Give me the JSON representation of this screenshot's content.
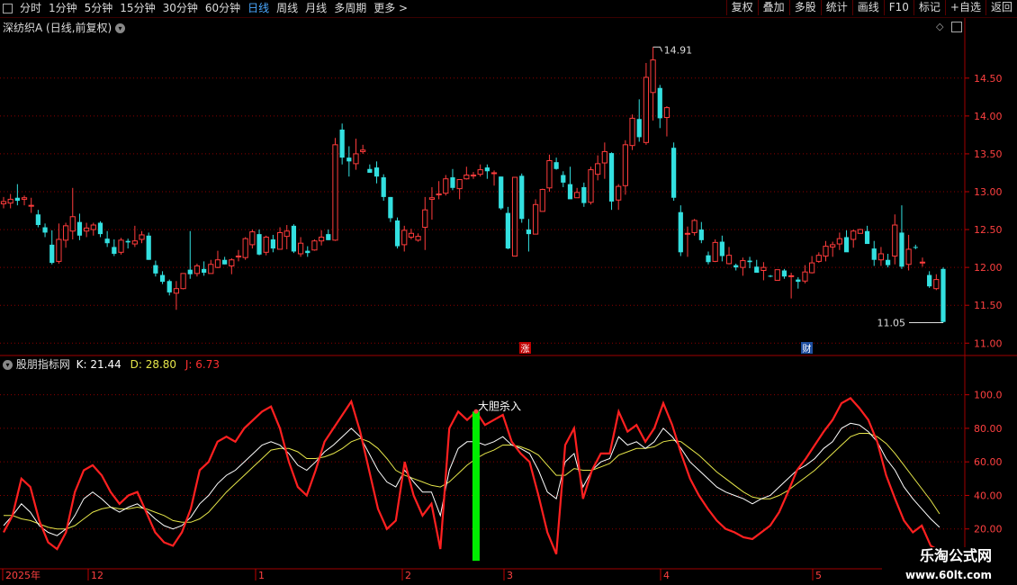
{
  "toolbar": {
    "periods": [
      "分时",
      "1分钟",
      "5分钟",
      "15分钟",
      "30分钟",
      "60分钟",
      "日线",
      "周线",
      "月线",
      "多周期",
      "更多 >"
    ],
    "active_period": "日线",
    "buttons": [
      "复权",
      "叠加",
      "多股",
      "统计",
      "画线",
      "F10",
      "标记",
      "+自选",
      "返回"
    ]
  },
  "main_chart": {
    "title": "深纺织A",
    "subtitle": "(日线,前复权)",
    "y_ticks": [
      "14.50",
      "14.00",
      "13.50",
      "13.00",
      "12.50",
      "12.00",
      "11.50",
      "11.00"
    ],
    "high_label": "14.91",
    "low_label": "11.05",
    "markers": [
      {
        "text": "涨",
        "color": "#c00000"
      },
      {
        "text": "财",
        "color": "#1f4fa0"
      }
    ]
  },
  "indicator": {
    "name": "股朋指标网",
    "k_label": "K: 21.44",
    "d_label": "D: 28.80",
    "j_label": "J: 6.73",
    "y_ticks": [
      "100.0",
      "80.00",
      "60.00",
      "40.00",
      "20.00"
    ],
    "signal_label": "大胆杀入"
  },
  "x_axis": {
    "labels": [
      "2025年",
      "12",
      "1",
      "2",
      "3",
      "4",
      "5"
    ]
  },
  "watermark": {
    "line1": "乐淘公式网",
    "line2": "www.60lt.com"
  },
  "colors": {
    "up": "#ff3c3c",
    "down": "#33e0e0",
    "k": "#ffffff",
    "d": "#e6e64a",
    "j": "#ff2020",
    "signal_bar": "#00ee00",
    "grid": "#8b0000"
  },
  "chart_data": {
    "type": "candlestick",
    "candles": [
      [
        12.84,
        12.93,
        12.78,
        12.87
      ],
      [
        12.85,
        12.97,
        12.78,
        12.9
      ],
      [
        12.92,
        13.1,
        12.82,
        12.88
      ],
      [
        12.9,
        12.95,
        12.82,
        12.92
      ],
      [
        12.82,
        12.92,
        12.72,
        12.82
      ],
      [
        12.7,
        12.76,
        12.53,
        12.56
      ],
      [
        12.53,
        12.58,
        12.4,
        12.46
      ],
      [
        12.3,
        12.49,
        12.04,
        12.06
      ],
      [
        12.08,
        12.58,
        12.05,
        12.37
      ],
      [
        12.36,
        12.59,
        12.26,
        12.55
      ],
      [
        12.48,
        13.05,
        12.37,
        12.67
      ],
      [
        12.6,
        12.71,
        12.36,
        12.42
      ],
      [
        12.48,
        12.59,
        12.4,
        12.52
      ],
      [
        12.5,
        12.59,
        12.42,
        12.56
      ],
      [
        12.59,
        12.61,
        12.4,
        12.44
      ],
      [
        12.38,
        12.48,
        12.27,
        12.32
      ],
      [
        12.27,
        12.37,
        12.15,
        12.18
      ],
      [
        12.2,
        12.39,
        12.17,
        12.36
      ],
      [
        12.35,
        12.38,
        12.25,
        12.33
      ],
      [
        12.31,
        12.55,
        12.27,
        12.35
      ],
      [
        12.37,
        12.48,
        12.32,
        12.43
      ],
      [
        12.42,
        12.46,
        12.1,
        12.1
      ],
      [
        12.03,
        12.09,
        11.88,
        11.92
      ],
      [
        11.9,
        11.95,
        11.78,
        11.81
      ],
      [
        11.82,
        11.84,
        11.63,
        11.67
      ],
      [
        11.66,
        11.82,
        11.44,
        11.72
      ],
      [
        11.72,
        11.92,
        11.71,
        11.92
      ],
      [
        11.97,
        12.48,
        11.85,
        11.91
      ],
      [
        11.92,
        12.05,
        11.88,
        12.02
      ],
      [
        11.98,
        12.08,
        11.89,
        11.93
      ],
      [
        11.92,
        12.1,
        11.92,
        12.04
      ],
      [
        12.0,
        12.22,
        11.99,
        12.1
      ],
      [
        12.1,
        12.14,
        12.04,
        12.04
      ],
      [
        12.02,
        12.12,
        11.91,
        12.1
      ],
      [
        12.14,
        12.23,
        12.08,
        12.15
      ],
      [
        12.13,
        12.4,
        12.1,
        12.38
      ],
      [
        12.3,
        12.5,
        12.25,
        12.47
      ],
      [
        12.44,
        12.5,
        12.16,
        12.17
      ],
      [
        12.2,
        12.42,
        12.16,
        12.4
      ],
      [
        12.37,
        12.43,
        12.2,
        12.25
      ],
      [
        12.24,
        12.53,
        12.24,
        12.46
      ],
      [
        12.41,
        12.56,
        12.24,
        12.48
      ],
      [
        12.55,
        12.57,
        12.19,
        12.21
      ],
      [
        12.18,
        12.4,
        12.14,
        12.32
      ],
      [
        12.22,
        12.28,
        12.14,
        12.19
      ],
      [
        12.23,
        12.37,
        12.22,
        12.35
      ],
      [
        12.35,
        12.49,
        12.29,
        12.4
      ],
      [
        12.44,
        12.5,
        12.36,
        12.36
      ],
      [
        12.36,
        13.71,
        12.35,
        13.62
      ],
      [
        13.82,
        13.9,
        13.36,
        13.45
      ],
      [
        13.45,
        13.6,
        13.2,
        13.4
      ],
      [
        13.37,
        13.7,
        13.29,
        13.5
      ],
      [
        13.53,
        13.62,
        13.5,
        13.55
      ],
      [
        13.3,
        13.36,
        13.25,
        13.25
      ],
      [
        13.32,
        13.4,
        13.11,
        13.2
      ],
      [
        13.19,
        13.23,
        12.88,
        12.93
      ],
      [
        12.93,
        12.93,
        12.6,
        12.65
      ],
      [
        12.62,
        12.66,
        12.25,
        12.28
      ],
      [
        12.3,
        12.55,
        12.21,
        12.49
      ],
      [
        12.4,
        12.51,
        12.37,
        12.45
      ],
      [
        12.36,
        12.45,
        12.34,
        12.41
      ],
      [
        12.53,
        12.93,
        12.23,
        12.76
      ],
      [
        12.9,
        13.06,
        12.63,
        12.92
      ],
      [
        12.96,
        13.14,
        12.9,
        12.97
      ],
      [
        12.98,
        13.22,
        12.95,
        13.17
      ],
      [
        13.19,
        13.3,
        13.02,
        13.05
      ],
      [
        13.04,
        13.16,
        12.9,
        13.16
      ],
      [
        13.17,
        13.33,
        13.16,
        13.22
      ],
      [
        13.21,
        13.26,
        13.17,
        13.22
      ],
      [
        13.23,
        13.36,
        13.2,
        13.29
      ],
      [
        13.32,
        13.36,
        13.17,
        13.27
      ],
      [
        13.24,
        13.28,
        13.08,
        13.25
      ],
      [
        13.2,
        13.2,
        12.76,
        12.78
      ],
      [
        12.72,
        12.8,
        12.24,
        12.25
      ],
      [
        12.15,
        13.19,
        12.15,
        13.19
      ],
      [
        13.21,
        13.24,
        12.59,
        12.64
      ],
      [
        12.5,
        12.64,
        12.21,
        12.44
      ],
      [
        12.44,
        12.9,
        12.44,
        12.83
      ],
      [
        12.74,
        13.04,
        12.74,
        13.03
      ],
      [
        13.05,
        13.49,
        13.0,
        13.41
      ],
      [
        13.39,
        13.45,
        13.29,
        13.3
      ],
      [
        13.22,
        13.27,
        13.06,
        13.12
      ],
      [
        13.1,
        13.33,
        13.04,
        12.9
      ],
      [
        12.92,
        13.05,
        12.93,
        12.99
      ],
      [
        13.06,
        13.12,
        12.8,
        12.85
      ],
      [
        12.86,
        13.33,
        12.83,
        13.29
      ],
      [
        13.23,
        13.48,
        13.15,
        13.37
      ],
      [
        13.38,
        13.65,
        13.17,
        13.53
      ],
      [
        13.51,
        13.52,
        12.76,
        12.87
      ],
      [
        12.89,
        13.1,
        12.76,
        13.07
      ],
      [
        13.08,
        13.68,
        12.96,
        13.62
      ],
      [
        13.61,
        14.02,
        13.55,
        13.97
      ],
      [
        13.96,
        14.22,
        13.66,
        13.72
      ],
      [
        13.65,
        14.7,
        13.62,
        14.51
      ],
      [
        14.31,
        14.91,
        13.94,
        14.74
      ],
      [
        14.37,
        14.41,
        13.84,
        13.97
      ],
      [
        13.98,
        14.13,
        13.73,
        14.11
      ],
      [
        13.58,
        13.65,
        12.88,
        12.92
      ],
      [
        12.73,
        12.82,
        12.15,
        12.2
      ],
      [
        12.45,
        12.54,
        12.14,
        12.45
      ],
      [
        12.46,
        12.64,
        12.42,
        12.62
      ],
      [
        12.5,
        12.6,
        12.32,
        12.36
      ],
      [
        12.16,
        12.21,
        12.04,
        12.07
      ],
      [
        12.08,
        12.37,
        12.07,
        12.33
      ],
      [
        12.34,
        12.42,
        12.08,
        12.15
      ],
      [
        12.05,
        12.27,
        12.04,
        12.16
      ],
      [
        12.03,
        12.05,
        11.96,
        12.0
      ],
      [
        12.0,
        12.13,
        11.89,
        12.09
      ],
      [
        12.09,
        12.14,
        11.99,
        12.07
      ],
      [
        12.01,
        12.1,
        11.93,
        11.93
      ],
      [
        11.96,
        12.07,
        11.83,
        12.0
      ],
      [
        11.89,
        11.9,
        11.87,
        11.88
      ],
      [
        11.83,
        11.94,
        11.86,
        11.97
      ],
      [
        11.96,
        11.98,
        11.85,
        11.88
      ],
      [
        11.88,
        11.93,
        11.59,
        11.89
      ],
      [
        11.84,
        11.87,
        11.72,
        11.81
      ],
      [
        11.82,
        12.03,
        11.79,
        11.94
      ],
      [
        11.93,
        12.15,
        11.92,
        12.06
      ],
      [
        12.08,
        12.2,
        12.06,
        12.16
      ],
      [
        12.15,
        12.35,
        12.08,
        12.28
      ],
      [
        12.27,
        12.34,
        12.14,
        12.3
      ],
      [
        12.31,
        12.46,
        12.23,
        12.38
      ],
      [
        12.4,
        12.49,
        12.26,
        12.2
      ],
      [
        12.37,
        12.5,
        12.26,
        12.48
      ],
      [
        12.45,
        12.51,
        12.46,
        12.5
      ],
      [
        12.48,
        12.55,
        12.34,
        12.31
      ],
      [
        12.25,
        12.35,
        12.02,
        12.1
      ],
      [
        12.1,
        12.27,
        12.02,
        12.18
      ],
      [
        12.1,
        12.18,
        12.0,
        12.03
      ],
      [
        12.15,
        12.7,
        12.04,
        12.56
      ],
      [
        12.46,
        12.82,
        11.98,
        12.01
      ],
      [
        12.04,
        12.43,
        11.96,
        12.24
      ],
      [
        12.27,
        12.3,
        12.24,
        12.26
      ],
      [
        12.07,
        12.13,
        12.01,
        12.07
      ],
      [
        11.9,
        11.95,
        11.73,
        11.75
      ],
      [
        11.72,
        11.91,
        11.7,
        11.84
      ],
      [
        11.98,
        12.0,
        11.27,
        11.28
      ]
    ],
    "kdj": {
      "K": [
        22,
        28,
        35,
        30,
        22,
        18,
        16,
        20,
        28,
        38,
        42,
        38,
        33,
        30,
        33,
        35,
        31,
        26,
        22,
        20,
        22,
        27,
        35,
        40,
        47,
        52,
        55,
        60,
        65,
        70,
        72,
        70,
        65,
        58,
        55,
        60,
        66,
        70,
        75,
        80,
        75,
        65,
        55,
        48,
        45,
        55,
        48,
        42,
        42,
        28,
        55,
        68,
        72,
        72,
        70,
        72,
        75,
        70,
        68,
        65,
        55,
        42,
        38,
        60,
        65,
        45,
        55,
        60,
        62,
        75,
        70,
        72,
        68,
        72,
        80,
        75,
        68,
        60,
        55,
        50,
        45,
        42,
        40,
        38,
        35,
        38,
        40,
        45,
        50,
        55,
        58,
        62,
        68,
        72,
        80,
        83,
        82,
        78,
        72,
        62,
        55,
        45,
        38,
        32,
        26,
        21
      ],
      "D": [
        28,
        28,
        26,
        25,
        23,
        21,
        20,
        20,
        22,
        26,
        30,
        32,
        33,
        32,
        32,
        33,
        32,
        30,
        28,
        25,
        24,
        24,
        26,
        30,
        36,
        42,
        47,
        52,
        57,
        62,
        67,
        68,
        68,
        66,
        62,
        62,
        63,
        65,
        68,
        72,
        74,
        72,
        68,
        62,
        55,
        52,
        50,
        48,
        46,
        45,
        48,
        53,
        58,
        62,
        65,
        67,
        70,
        70,
        69,
        67,
        64,
        58,
        52,
        52,
        56,
        55,
        55,
        57,
        59,
        64,
        66,
        68,
        68,
        69,
        72,
        73,
        72,
        68,
        64,
        59,
        54,
        50,
        46,
        42,
        39,
        38,
        38,
        40,
        43,
        47,
        51,
        55,
        60,
        65,
        70,
        75,
        77,
        77,
        75,
        71,
        65,
        58,
        51,
        44,
        37,
        29
      ],
      "J": [
        18,
        28,
        50,
        45,
        25,
        12,
        8,
        18,
        42,
        55,
        58,
        52,
        42,
        35,
        40,
        42,
        30,
        18,
        12,
        10,
        18,
        32,
        55,
        60,
        72,
        75,
        72,
        80,
        85,
        90,
        93,
        80,
        60,
        45,
        40,
        55,
        72,
        80,
        88,
        96,
        78,
        55,
        32,
        20,
        25,
        60,
        40,
        28,
        35,
        8,
        80,
        90,
        85,
        90,
        82,
        85,
        88,
        72,
        65,
        60,
        40,
        18,
        5,
        70,
        80,
        38,
        55,
        65,
        65,
        90,
        78,
        82,
        72,
        80,
        95,
        82,
        65,
        50,
        40,
        32,
        25,
        20,
        18,
        15,
        14,
        18,
        22,
        30,
        42,
        55,
        62,
        70,
        78,
        85,
        95,
        98,
        92,
        85,
        72,
        52,
        38,
        25,
        18,
        22,
        10,
        7
      ],
      "signal_index": 53
    }
  }
}
